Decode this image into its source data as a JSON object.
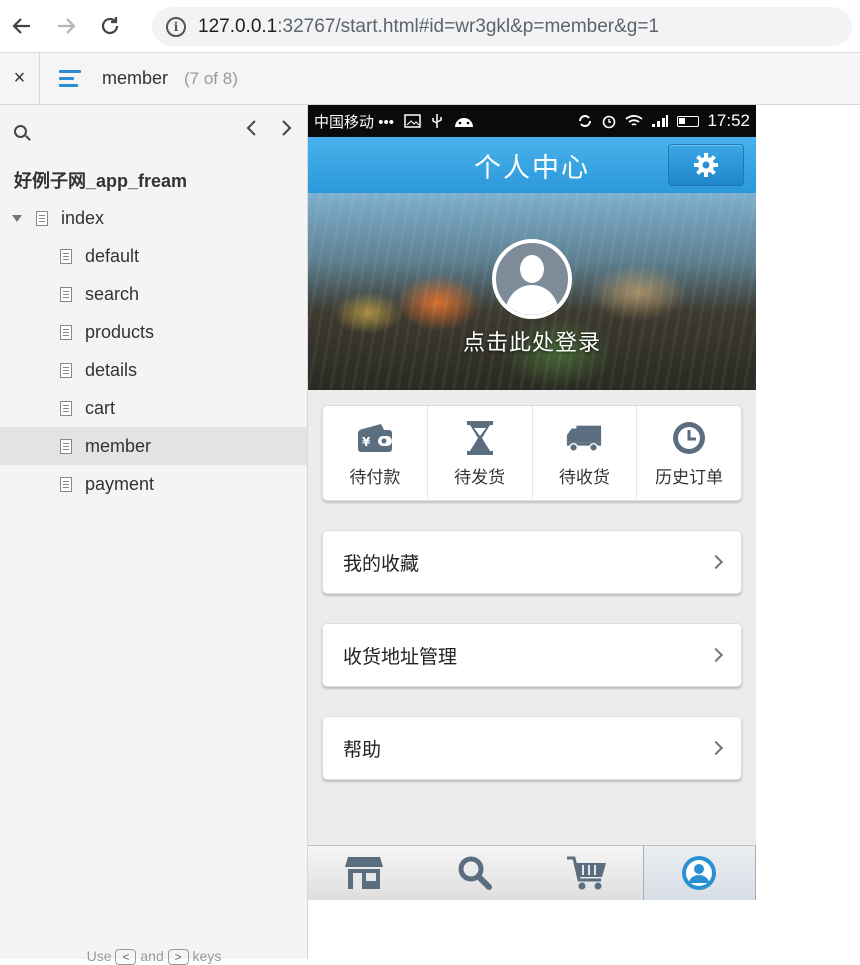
{
  "browser": {
    "url_host": "127.0.0.1",
    "url_rest": ":32767/start.html#id=wr3gkl&p=member&g=1",
    "back_icon": "arrow-left-icon",
    "forward_icon": "arrow-right-icon",
    "reload_icon": "reload-icon"
  },
  "toolbar": {
    "close_label": "×",
    "page_name": "member",
    "page_count": "(7 of 8)"
  },
  "sidebar": {
    "project": "好例子网_app_fream",
    "root": "index",
    "items": [
      {
        "label": "default"
      },
      {
        "label": "search"
      },
      {
        "label": "products"
      },
      {
        "label": "details"
      },
      {
        "label": "cart"
      },
      {
        "label": "member",
        "selected": true
      },
      {
        "label": "payment"
      }
    ],
    "footer_pre": "Use",
    "key_prev": "<",
    "footer_mid": "and",
    "key_next": ">",
    "footer_post": "keys"
  },
  "phone": {
    "status": {
      "carrier": "中国移动",
      "dots": "•••",
      "time": "17:52"
    },
    "header_title": "个人中心",
    "login_text": "点击此处登录",
    "orders": [
      {
        "label": "待付款",
        "icon": "wallet-icon"
      },
      {
        "label": "待发货",
        "icon": "hourglass-icon"
      },
      {
        "label": "待收货",
        "icon": "truck-icon"
      },
      {
        "label": "历史订单",
        "icon": "clock-icon"
      }
    ],
    "menu": [
      {
        "label": "我的收藏"
      },
      {
        "label": "收货地址管理"
      },
      {
        "label": "帮助"
      }
    ],
    "tabs": [
      {
        "icon": "store-icon"
      },
      {
        "icon": "search-icon"
      },
      {
        "icon": "cart-icon"
      },
      {
        "icon": "user-icon",
        "active": true
      }
    ],
    "colors": {
      "accent": "#2b98da",
      "icon": "#5b6e80"
    }
  }
}
